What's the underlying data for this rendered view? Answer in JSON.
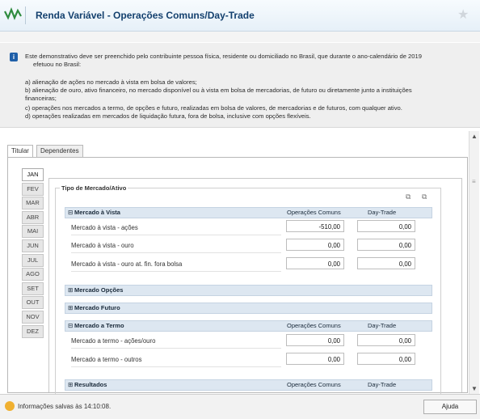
{
  "header": {
    "title": "Renda Variável - Operações Comuns/Day-Trade",
    "star_icon": "star-icon",
    "logo_icon": "receita-logo-icon"
  },
  "info": {
    "icon": "info-icon",
    "intro_1": "Este demonstrativo deve ser preenchido pelo contribuinte pessoa física, residente ou domiciliado no Brasil, que durante o ano-calendário de 2019",
    "intro_2": "efetuou no Brasil:",
    "a": "a) alienação de ações no mercado à vista em bolsa de valores;",
    "b1": "b) alienação de ouro, ativo financeiro, no mercado disponível ou à vista em bolsa de mercadorias, de futuro ou diretamente junto a instituições",
    "b2": "financeiras;",
    "c": "c) operações nos mercados a termo, de opções e futuro, realizadas em bolsa de valores, de mercadorias e de futuros, com qualquer ativo.",
    "d": "d) operações realizadas em mercados de liquidação futura, fora de bolsa, inclusive com opções flexíveis."
  },
  "tabs": [
    "Titular",
    "Dependentes"
  ],
  "months": [
    "JAN",
    "FEV",
    "MAR",
    "ABR",
    "MAI",
    "JUN",
    "JUL",
    "AGO",
    "SET",
    "OUT",
    "NOV",
    "DEZ"
  ],
  "fieldset_label": "Tipo de Mercado/Ativo",
  "sections": {
    "vista": {
      "label": "Mercado à Vista",
      "expand": "⊟",
      "col1": "Operações Comuns",
      "col2": "Day-Trade"
    },
    "opcoes": {
      "label": "Mercado Opções",
      "expand": "⊞"
    },
    "futuro": {
      "label": "Mercado Futuro",
      "expand": "⊞"
    },
    "termo": {
      "label": "Mercado a Termo",
      "expand": "⊟",
      "col1": "Operações Comuns",
      "col2": "Day-Trade"
    },
    "resultados": {
      "label": "Resultados",
      "expand": "⊞",
      "col1": "Operações Comuns",
      "col2": "Day-Trade"
    }
  },
  "rows": {
    "vista_acoes": {
      "label": "Mercado à vista - ações",
      "comuns": "-510,00",
      "day": "0,00"
    },
    "vista_ouro": {
      "label": "Mercado à vista - ouro",
      "comuns": "0,00",
      "day": "0,00"
    },
    "vista_ouro_fora": {
      "label": "Mercado à vista - ouro at. fin. fora bolsa",
      "comuns": "0,00",
      "day": "0,00"
    },
    "termo_acoes": {
      "label": "Mercado a termo - ações/ouro",
      "comuns": "0,00",
      "day": "0,00"
    },
    "termo_outros": {
      "label": "Mercado a termo - outros",
      "comuns": "0,00",
      "day": "0,00"
    }
  },
  "status": {
    "text": "Informações salvas às 14:10:08.",
    "help_label": "Ajuda"
  },
  "colors": {
    "header_title": "#13406e",
    "section_bg": "#dde7f1",
    "accent_logo": "#2e8b3e"
  }
}
